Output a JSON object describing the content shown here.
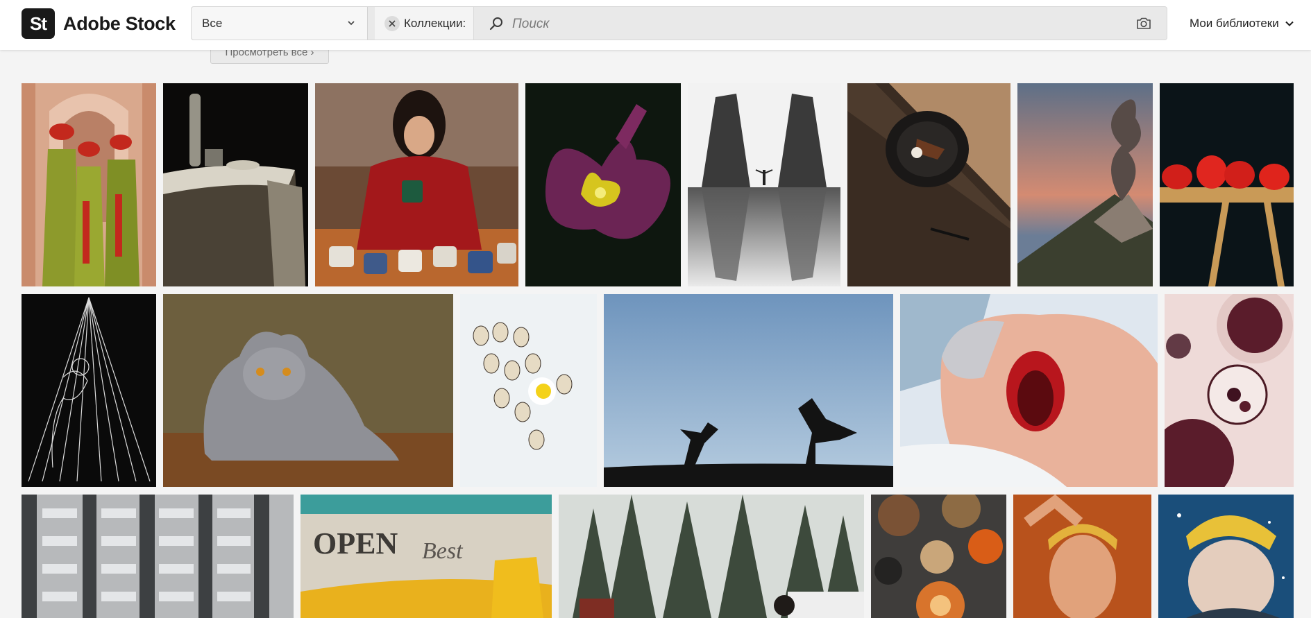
{
  "brand": {
    "mark": "St",
    "name": "Adobe Stock"
  },
  "search": {
    "type_value": "Все",
    "collections_label": "Коллекции:",
    "placeholder": "Поиск"
  },
  "nav": {
    "libraries_label": "Мои библиотеки"
  },
  "view_all_label": "Просмотреть все ›",
  "icons": {
    "dropdown": "chevron-down-icon",
    "clear": "close-icon",
    "search": "search-icon",
    "visual_search": "camera-icon",
    "libraries": "chevron-down-icon"
  },
  "colors": {
    "header_bg": "#ffffff",
    "page_bg": "#f4f4f4",
    "brand_mark": "#1a1a1a"
  },
  "gallery": {
    "rows": [
      {
        "items": [
          "Рабочие в зелёном",
          "Стол со скатертью",
          "Чашки кофе",
          "Орхидея",
          "Храмовые ворота",
          "Десерт на тарелке",
          "Вулкан",
          "Помидоры на столе"
        ]
      },
      {
        "items": [
          "Линейная иллюстрация",
          "Британский кот",
          "Перепелиные яйца",
          "Силуэты на холме",
          "Новорождённый",
          "Посуда сверху"
        ]
      },
      {
        "items": [
          "Фасад здания",
          "Вывеска OPEN",
          "Зимний лес",
          "Осенний натюрморт",
          "Портрет в повязке",
          "Пожилой мужчина в снегу"
        ]
      }
    ]
  }
}
